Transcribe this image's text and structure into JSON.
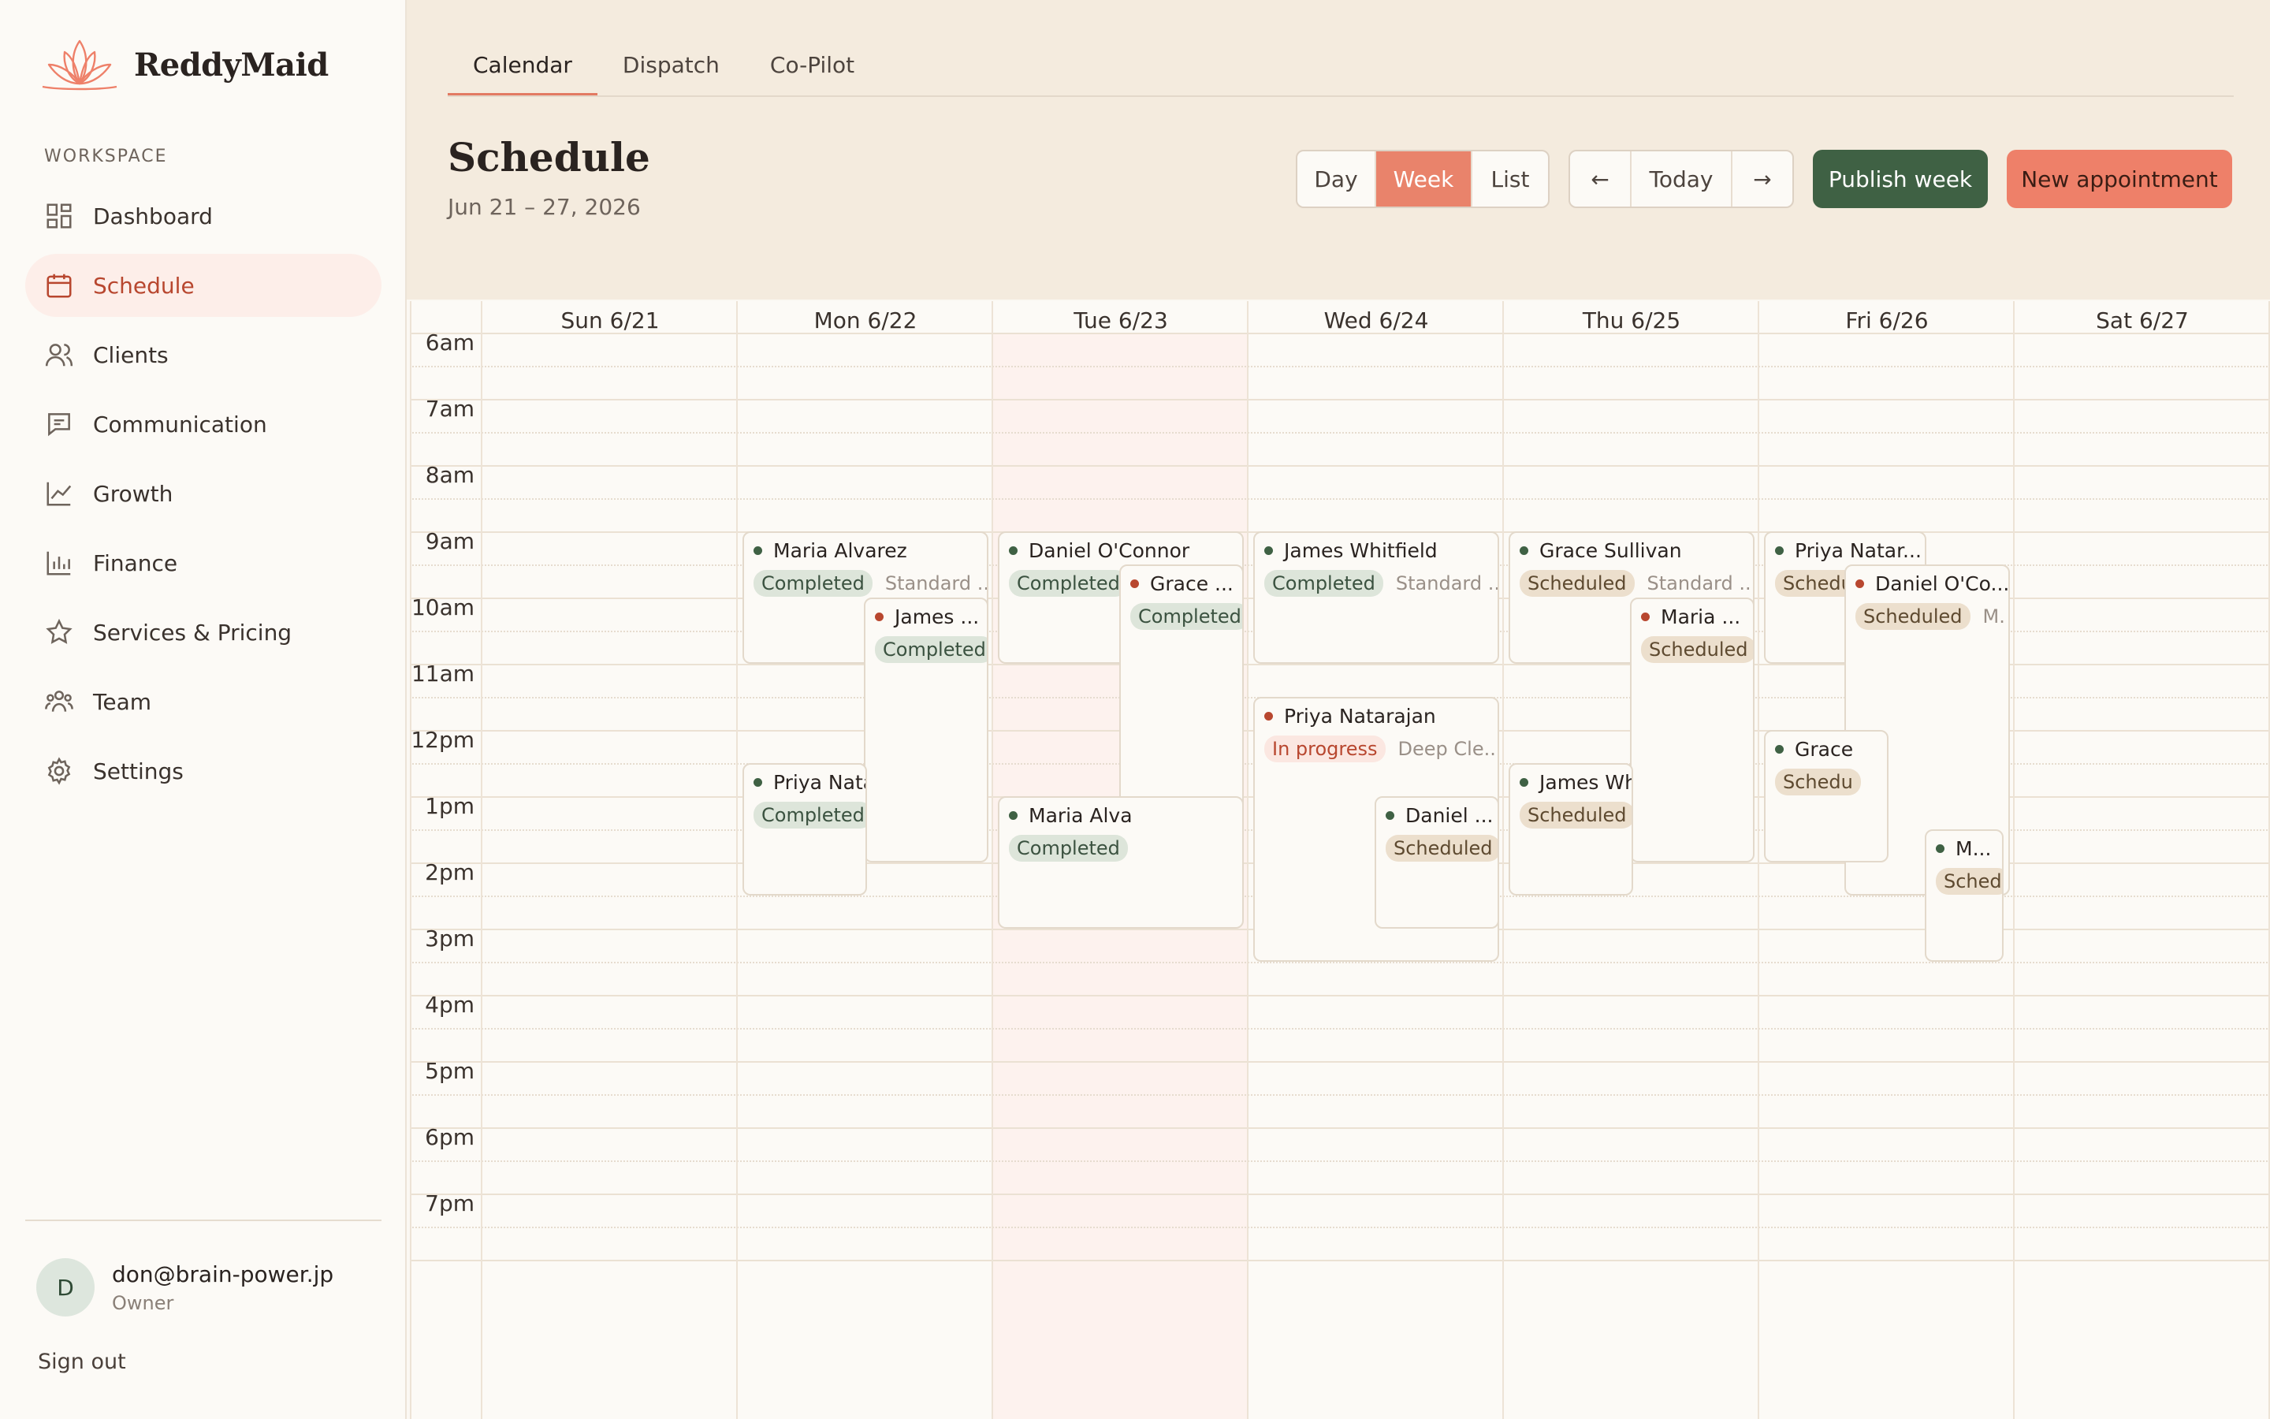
{
  "app": {
    "name": "ReddyMaid"
  },
  "sidebar": {
    "section_label": "WORKSPACE",
    "items": [
      {
        "label": "Dashboard",
        "icon": "grid-icon"
      },
      {
        "label": "Schedule",
        "icon": "calendar-icon",
        "active": true
      },
      {
        "label": "Clients",
        "icon": "users-icon"
      },
      {
        "label": "Communication",
        "icon": "message-icon"
      },
      {
        "label": "Growth",
        "icon": "trend-icon"
      },
      {
        "label": "Finance",
        "icon": "bar-chart-icon"
      },
      {
        "label": "Services & Pricing",
        "icon": "star-icon"
      },
      {
        "label": "Team",
        "icon": "team-icon"
      },
      {
        "label": "Settings",
        "icon": "gear-icon"
      }
    ],
    "user": {
      "initial": "D",
      "email": "don@brain-power.jp",
      "role": "Owner"
    },
    "sign_out": "Sign out"
  },
  "tabs": [
    {
      "label": "Calendar",
      "active": true
    },
    {
      "label": "Dispatch"
    },
    {
      "label": "Co-Pilot"
    }
  ],
  "header": {
    "title": "Schedule",
    "date_range": "Jun 21 – 27, 2026",
    "view_options": [
      "Day",
      "Week",
      "List"
    ],
    "active_view": "Week",
    "prev_label": "←",
    "today_label": "Today",
    "next_label": "→",
    "publish_label": "Publish week",
    "new_label": "New appointment"
  },
  "colors": {
    "accent": "#e9836b",
    "publish": "#3f6144",
    "completed_badge": "#dde5da",
    "scheduled_badge": "#ecdfcd",
    "in_progress": "#b8472f",
    "today_column": "#fdf2ee"
  },
  "calendar": {
    "days": [
      "Sun 6/21",
      "Mon 6/22",
      "Tue 6/23",
      "Wed 6/24",
      "Thu 6/25",
      "Fri 6/26",
      "Sat 6/27"
    ],
    "hours": [
      "6am",
      "7am",
      "8am",
      "9am",
      "10am",
      "11am",
      "12pm",
      "1pm",
      "2pm",
      "3pm",
      "4pm",
      "5pm",
      "6pm",
      "7pm"
    ],
    "appointments": [
      {
        "client": "Maria Alvarez",
        "day": "Mon 6/22",
        "start": "9:00",
        "end": "11:00",
        "status": "Completed",
        "service": "Standard ..."
      },
      {
        "client": "James ...",
        "day": "Mon 6/22",
        "start": "10:00",
        "end": "14:00",
        "status": "Completed",
        "service": ""
      },
      {
        "client": "Priya Nata",
        "day": "Mon 6/22",
        "start": "12:30",
        "end": "14:30",
        "status": "Completed",
        "service": ""
      },
      {
        "client": "Daniel O'Connor",
        "day": "Tue 6/23",
        "start": "9:00",
        "end": "11:00",
        "status": "Completed",
        "service": ""
      },
      {
        "client": "Grace ...",
        "day": "Tue 6/23",
        "start": "9:30",
        "end": "14:30",
        "status": "Completed",
        "service": ""
      },
      {
        "client": "Maria Alva",
        "day": "Tue 6/23",
        "start": "13:00",
        "end": "15:00",
        "status": "Completed",
        "service": ""
      },
      {
        "client": "James Whitfield",
        "day": "Wed 6/24",
        "start": "9:00",
        "end": "11:00",
        "status": "Completed",
        "service": "Standard ..."
      },
      {
        "client": "Priya Natarajan",
        "day": "Wed 6/24",
        "start": "11:30",
        "end": "15:30",
        "status": "In progress",
        "service": "Deep Cle..."
      },
      {
        "client": "Daniel ...",
        "day": "Wed 6/24",
        "start": "13:00",
        "end": "15:00",
        "status": "Scheduled",
        "service": ""
      },
      {
        "client": "Grace Sullivan",
        "day": "Thu 6/25",
        "start": "9:00",
        "end": "11:00",
        "status": "Scheduled",
        "service": "Standard ..."
      },
      {
        "client": "Maria ...",
        "day": "Thu 6/25",
        "start": "10:00",
        "end": "14:00",
        "status": "Scheduled",
        "service": ""
      },
      {
        "client": "James Wh",
        "day": "Thu 6/25",
        "start": "12:30",
        "end": "14:30",
        "status": "Scheduled",
        "service": ""
      },
      {
        "client": "Priya Natar...",
        "day": "Fri 6/26",
        "start": "9:00",
        "end": "11:00",
        "status": "Schedu",
        "service": ""
      },
      {
        "client": "Daniel O'Co...",
        "day": "Fri 6/26",
        "start": "9:30",
        "end": "14:30",
        "status": "Scheduled",
        "service": "M."
      },
      {
        "client": "Grace",
        "day": "Fri 6/26",
        "start": "12:00",
        "end": "14:00",
        "status": "Schedu",
        "service": ""
      },
      {
        "client": "M...",
        "day": "Fri 6/26",
        "start": "13:30",
        "end": "15:30",
        "status": "Sched",
        "service": ""
      }
    ]
  }
}
